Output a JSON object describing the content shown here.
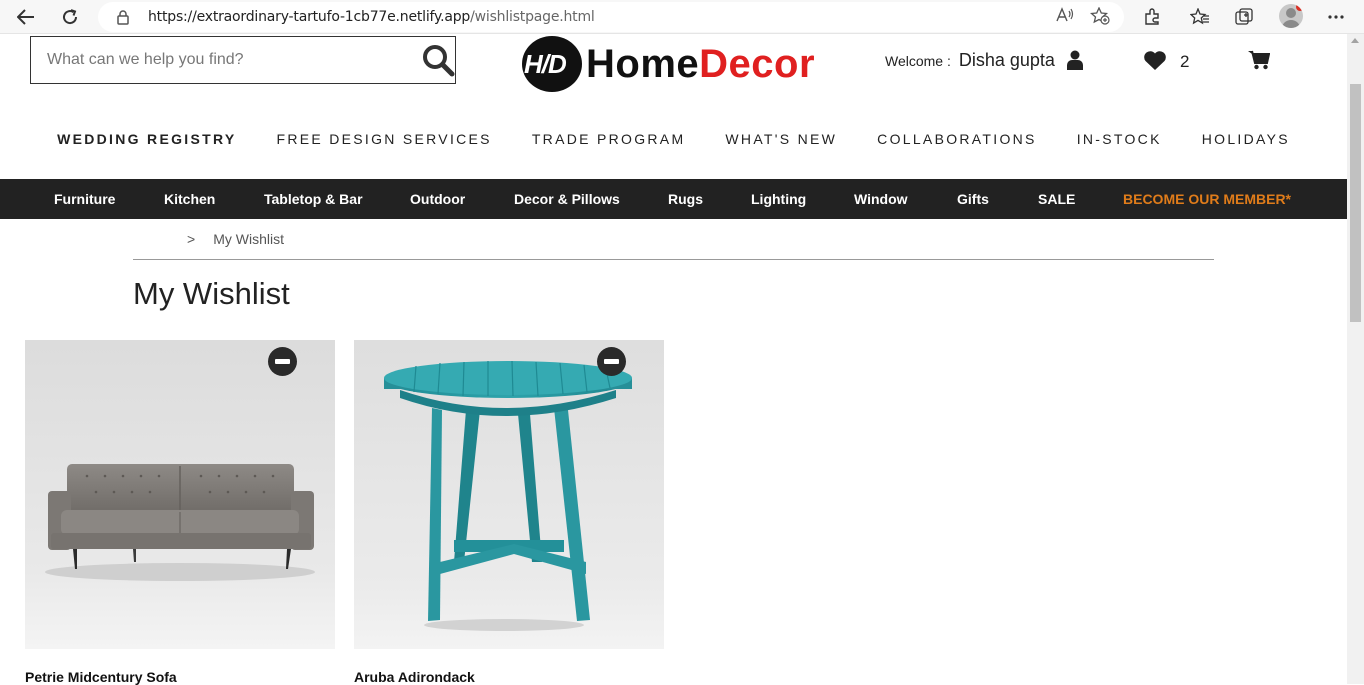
{
  "browser": {
    "url_host": "https://extraordinary-tartufo-1cb77e.netlify.app",
    "url_path": "/wishlistpage.html"
  },
  "header": {
    "search_placeholder": "What can we help you find?",
    "logo_badge": "H/D",
    "logo_word_1": "Home",
    "logo_word_2": "Decor",
    "welcome_label": "Welcome :",
    "user_name": "Disha gupta",
    "wishlist_count": "2"
  },
  "top_nav": [
    "WEDDING REGISTRY",
    "FREE DESIGN SERVICES",
    "TRADE PROGRAM",
    "WHAT'S NEW",
    "COLLABORATIONS",
    "IN-STOCK",
    "HOLIDAYS"
  ],
  "categories": [
    "Furniture",
    "Kitchen",
    "Tabletop & Bar",
    "Outdoor",
    "Decor & Pillows",
    "Rugs",
    "Lighting",
    "Window",
    "Gifts",
    "SALE",
    "BECOME OUR MEMBER*"
  ],
  "breadcrumb": {
    "separator": ">",
    "current": "My Wishlist"
  },
  "page_title": "My Wishlist",
  "wishlist": [
    {
      "name": "Petrie Midcentury Sofa",
      "image": "gray-sofa"
    },
    {
      "name": "Aruba Adirondack",
      "image": "teal-side-table"
    }
  ],
  "colors": {
    "brand_red": "#e02020",
    "member_orange": "#e07c1a",
    "category_bar": "#222222",
    "teal": "#2a9aa3"
  }
}
